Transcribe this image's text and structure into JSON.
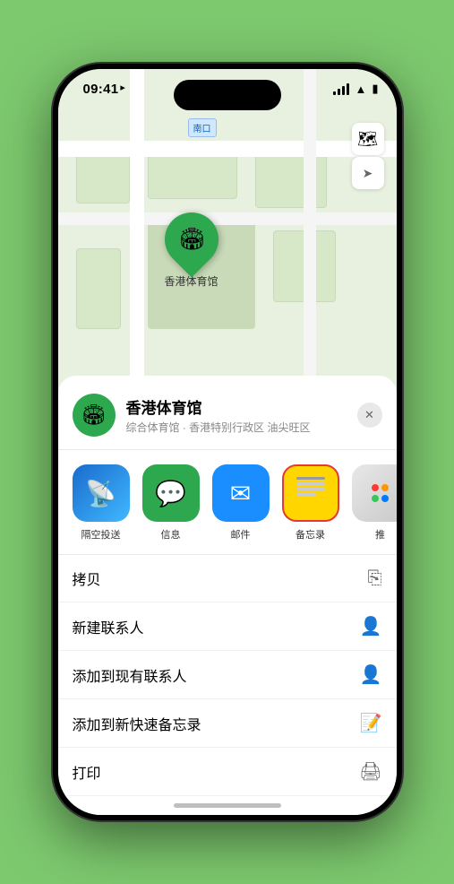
{
  "status_bar": {
    "time": "09:41",
    "location_arrow": "▲"
  },
  "map": {
    "label": "南口",
    "map_type_icon": "🗺",
    "location_icon": "⊕"
  },
  "pin": {
    "label": "香港体育馆",
    "icon": "🏟"
  },
  "venue": {
    "name": "香港体育馆",
    "subtitle": "综合体育馆 · 香港特别行政区 油尖旺区",
    "icon": "🏟"
  },
  "share_items": [
    {
      "id": "airdrop",
      "label": "隔空投送",
      "icon": "📡",
      "class": "airdrop"
    },
    {
      "id": "message",
      "label": "信息",
      "icon": "💬",
      "class": "message"
    },
    {
      "id": "mail",
      "label": "邮件",
      "icon": "✉",
      "class": "mail"
    },
    {
      "id": "notes",
      "label": "备忘录",
      "icon": "📋",
      "class": "notes"
    },
    {
      "id": "more",
      "label": "推",
      "icon": "···",
      "class": "more"
    }
  ],
  "menu_items": [
    {
      "label": "拷贝",
      "icon": "📋"
    },
    {
      "label": "新建联系人",
      "icon": "👤"
    },
    {
      "label": "添加到现有联系人",
      "icon": "👤"
    },
    {
      "label": "添加到新快速备忘录",
      "icon": "📝"
    },
    {
      "label": "打印",
      "icon": "🖨"
    }
  ],
  "close_btn": "✕"
}
